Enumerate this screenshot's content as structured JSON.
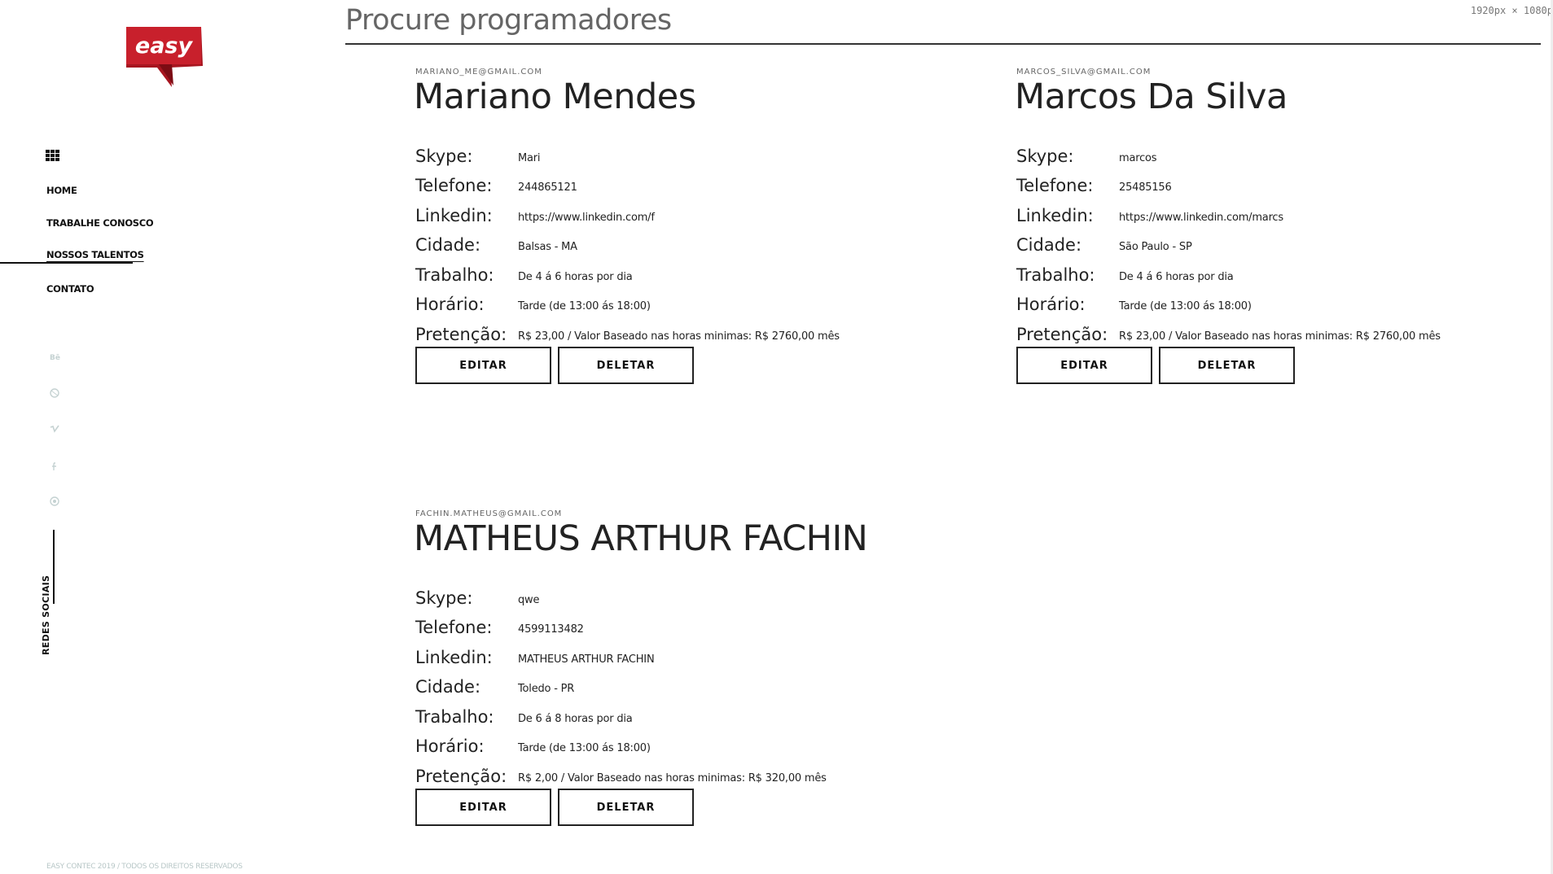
{
  "viewport_readout": "1920px × 1080p",
  "logo": {
    "text": "easy",
    "color": "#c01f2a"
  },
  "sidebar": {
    "grid_icon": "grid-icon",
    "nav": [
      "HOME",
      "TRABALHE CONOSCO",
      "NOSSOS TALENTOS",
      "CONTATO"
    ],
    "active_item": "NOSSOS TALENTOS",
    "social_icons": [
      "behance-icon",
      "dribbble-icon",
      "vimeo-icon",
      "facebook-icon",
      "globe-icon"
    ],
    "social_label": "REDES SOCIAIS",
    "footer": "EASY CONTEC 2019 / TODOS OS DIREITOS RESERVADOS"
  },
  "page": {
    "title": "Procure programadores"
  },
  "labels": {
    "skype": "Skype:",
    "telefone": "Telefone:",
    "linkedin": "Linkedin:",
    "cidade": "Cidade:",
    "trabalho": "Trabalho:",
    "horario": "Horário:",
    "pretencao": "Pretenção:",
    "edit": "EDITAR",
    "delete": "DELETAR"
  },
  "developers": [
    {
      "email": "MARIANO_ME@GMAIL.COM",
      "name": "Mariano Mendes",
      "skype": "Mari",
      "telefone": "244865121",
      "linkedin": "https://www.linkedin.com/f",
      "cidade": "Balsas - MA",
      "trabalho": "De 4 á 6 horas por dia",
      "horario": "Tarde (de 13:00 ás 18:00)",
      "pretencao": "R$ 23,00 / Valor Baseado nas horas minimas: R$ 2760,00 mês"
    },
    {
      "email": "MARCOS_SILVA@GMAIL.COM",
      "name": "Marcos Da Silva",
      "skype": "marcos",
      "telefone": "25485156",
      "linkedin": "https://www.linkedin.com/marcs",
      "cidade": "São Paulo - SP",
      "trabalho": "De 4 á 6 horas por dia",
      "horario": "Tarde (de 13:00 ás 18:00)",
      "pretencao": "R$ 23,00 / Valor Baseado nas horas minimas: R$ 2760,00 mês"
    },
    {
      "email": "FACHIN.MATHEUS@GMAIL.COM",
      "name": "MATHEUS ARTHUR FACHIN",
      "skype": "qwe",
      "telefone": "4599113482",
      "linkedin": "MATHEUS ARTHUR FACHIN",
      "cidade": "Toledo - PR",
      "trabalho": "De 6 á 8 horas por dia",
      "horario": "Tarde (de 13:00 ás 18:00)",
      "pretencao": "R$ 2,00 / Valor Baseado nas horas minimas: R$ 320,00 mês"
    }
  ]
}
